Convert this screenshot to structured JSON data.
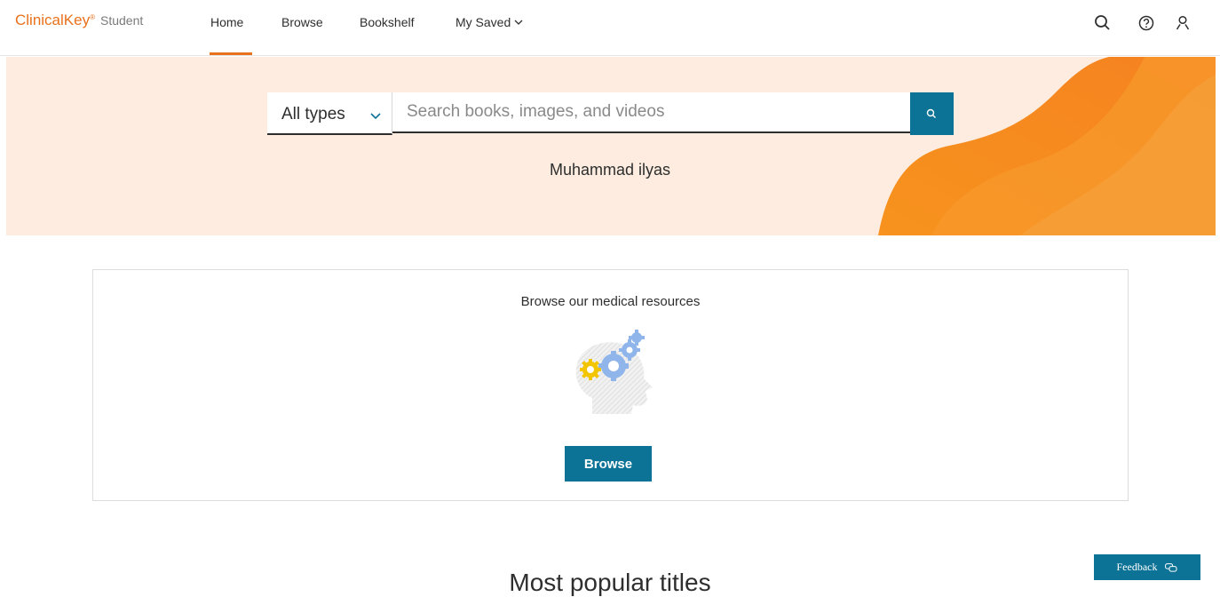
{
  "brand": {
    "name": "ClinicalKey",
    "mark": "®",
    "product": "Student",
    "color": "#e9711c"
  },
  "nav": {
    "items": [
      {
        "label": "Home",
        "active": true
      },
      {
        "label": "Browse"
      },
      {
        "label": "Bookshelf"
      },
      {
        "label": "My Saved"
      }
    ],
    "icons": [
      "search-icon",
      "help-icon",
      "user-icon"
    ]
  },
  "hero": {
    "type_select": {
      "selected": "All types"
    },
    "search": {
      "placeholder": "Search books, images, and videos",
      "value": ""
    },
    "user_name": "Muhammad ilyas"
  },
  "browse_card": {
    "title": "Browse our medical resources",
    "button_label": "Browse"
  },
  "section_title": "Most popular titles",
  "feedback_label": "Feedback",
  "colors": {
    "accent": "#e9711c",
    "primary_button": "#0c7396",
    "hero_bg": "#fdecdf"
  }
}
